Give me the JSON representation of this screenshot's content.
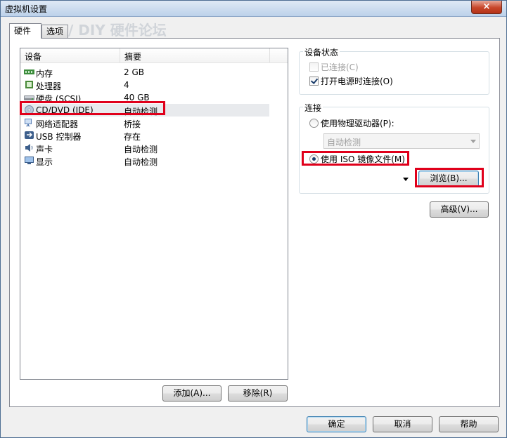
{
  "window": {
    "title": "虚拟机设置",
    "close_label": "×"
  },
  "tabs": [
    {
      "label": "硬件",
      "active": true
    },
    {
      "label": "选项",
      "active": false
    }
  ],
  "device_list": {
    "headers": {
      "device": "设备",
      "summary": "摘要"
    },
    "rows": [
      {
        "name": "内存",
        "value": "2 GB",
        "icon": "memory-icon"
      },
      {
        "name": "处理器",
        "value": "4",
        "icon": "processor-icon"
      },
      {
        "name": "硬盘 (SCSI)",
        "value": "40 GB",
        "icon": "harddisk-icon"
      },
      {
        "name": "CD/DVD (IDE)",
        "value": "自动检测",
        "icon": "cd-dvd-icon",
        "selected": true
      },
      {
        "name": "网络适配器",
        "value": "桥接",
        "icon": "network-adapter-icon"
      },
      {
        "name": "USB 控制器",
        "value": "存在",
        "icon": "usb-icon"
      },
      {
        "name": "声卡",
        "value": "自动检测",
        "icon": "sound-card-icon"
      },
      {
        "name": "显示",
        "value": "自动检测",
        "icon": "display-icon"
      }
    ]
  },
  "list_buttons": {
    "add": "添加(A)...",
    "remove": "移除(R)"
  },
  "device_status": {
    "label": "设备状态",
    "connected": {
      "label": "已连接(C)",
      "checked": false,
      "disabled": true
    },
    "connect_at_power_on": {
      "label": "打开电源时连接(O)",
      "checked": true
    }
  },
  "connection": {
    "label": "连接",
    "physical": {
      "label": "使用物理驱动器(P):",
      "selected": false
    },
    "physical_value": "自动检测",
    "iso": {
      "label": "使用 ISO 镜像文件(M)",
      "selected": true
    },
    "iso_value": "",
    "browse": "浏览(B)..."
  },
  "advanced": "高级(V)...",
  "footer": {
    "ok": "确定",
    "cancel": "取消",
    "help": "帮助"
  },
  "colors": {
    "highlight": "#e0001b",
    "selected_row": "#e8eaed"
  }
}
